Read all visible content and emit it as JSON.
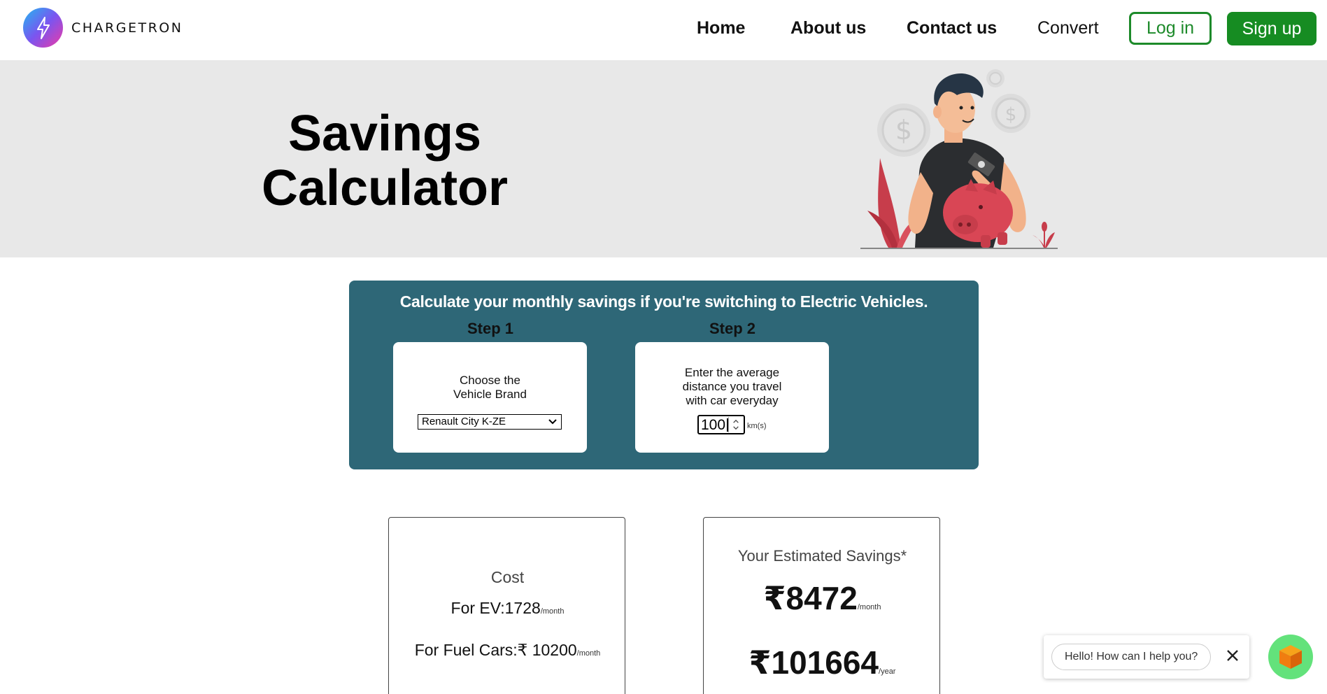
{
  "nav": {
    "brand": "CHARGETRON",
    "links": [
      "Home",
      "About us",
      "Contact us",
      "Convert"
    ],
    "login": "Log in",
    "signup": "Sign up"
  },
  "hero": {
    "title_line1": "Savings",
    "title_line2": "Calculator"
  },
  "calculator": {
    "heading": "Calculate your monthly savings if you're switching to Electric Vehicles.",
    "step1": {
      "label": "Step 1",
      "text_line1": "Choose the",
      "text_line2": "Vehicle Brand",
      "selected_vehicle": "Renault City K-ZE"
    },
    "step2": {
      "label": "Step 2",
      "text_line1": "Enter the average",
      "text_line2": "distance you travel",
      "text_line3": "with car everyday",
      "distance_value": "100",
      "unit": "km(s)"
    }
  },
  "cost": {
    "title": "Cost",
    "ev_label": "For EV:",
    "ev_value": "1728",
    "fuel_label": "For Fuel Cars:",
    "fuel_value": "₹ 10200",
    "per_month": "/month"
  },
  "savings": {
    "title": "Your Estimated Savings*",
    "monthly": "₹8472",
    "monthly_unit": "/month",
    "yearly": "₹101664",
    "yearly_unit": "/year"
  },
  "chat": {
    "greeting": "Hello! How can I help you?"
  },
  "colors": {
    "accent_green": "#168c22",
    "panel_teal": "#2e6777",
    "hero_bg": "#e8e8e8",
    "chat_green": "#63e27b"
  }
}
